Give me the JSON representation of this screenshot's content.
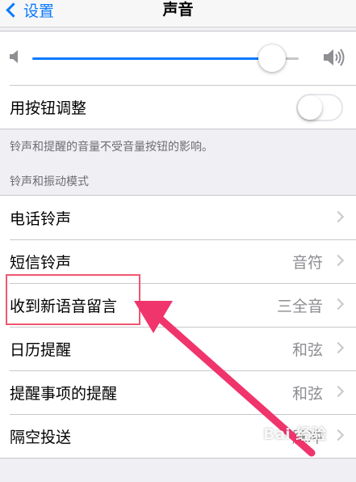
{
  "nav": {
    "back_label": "设置",
    "title": "声音"
  },
  "volume": {
    "level": 0.9
  },
  "adjust_with_buttons": {
    "label": "用按钮调整",
    "on": false
  },
  "footer_note": "铃声和提醒的音量不受音量按钮的影响。",
  "section_header": "铃声和振动模式",
  "sound_rows": [
    {
      "label": "电话铃声",
      "value": ""
    },
    {
      "label": "短信铃声",
      "value": "音符"
    },
    {
      "label": "收到新语音留言",
      "value": "三全音"
    },
    {
      "label": "日历提醒",
      "value": "和弦"
    },
    {
      "label": "提醒事项的提醒",
      "value": "和弦"
    },
    {
      "label": "隔空投送",
      "value": "脉冲"
    }
  ],
  "annotation": {
    "color": "#f0346c"
  },
  "watermark": {
    "text": "Bai 经验"
  },
  "colors": {
    "accent": "#0a7aff",
    "background": "#efeff4"
  }
}
